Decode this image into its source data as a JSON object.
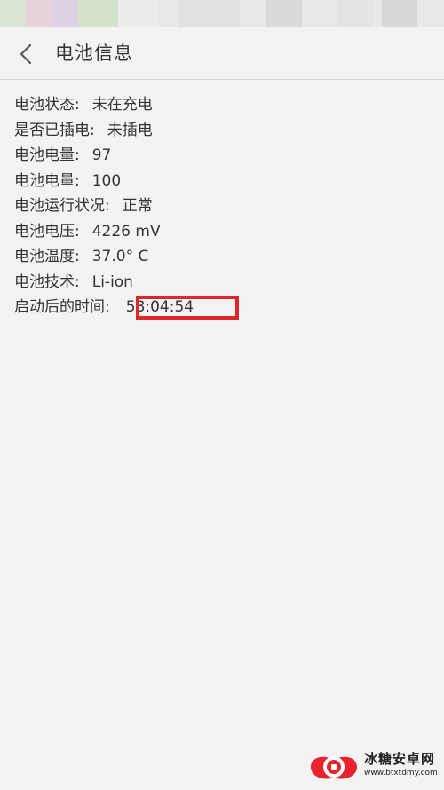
{
  "header": {
    "title": "电池信息",
    "back_icon": "chevron-left-icon"
  },
  "battery_info": [
    {
      "label": "电池状态:",
      "value": "未在充电"
    },
    {
      "label": "是否已插电:",
      "value": "未插电"
    },
    {
      "label": "电池电量:",
      "value": "97"
    },
    {
      "label": "电池电量:",
      "value": "100"
    },
    {
      "label": "电池运行状况:",
      "value": "正常"
    },
    {
      "label": "电池电压:",
      "value": "4226 mV"
    },
    {
      "label": "电池温度:",
      "value": "37.0° C"
    },
    {
      "label": "电池技术:",
      "value": "Li-ion"
    },
    {
      "label": "启动后的时间:",
      "value": "58:04:54"
    }
  ],
  "highlight": {
    "color": "#e0262b"
  },
  "watermark": {
    "name": "冰糖安卓网",
    "url": "www.btxtdmy.com",
    "logo_color": "#e8232e"
  }
}
